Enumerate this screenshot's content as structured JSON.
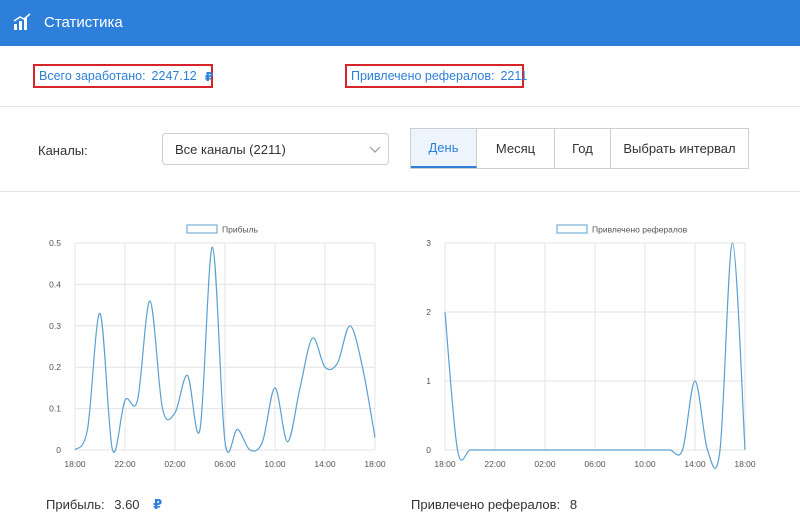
{
  "header": {
    "title": "Статистика",
    "icon": "bar-chart-icon"
  },
  "stats": {
    "earned_label": "Всего заработано:",
    "earned_value": "2247.12",
    "currency": "₽",
    "refs_label": "Привлечено рефералов:",
    "refs_value": "2211"
  },
  "filters": {
    "channels_label": "Каналы:",
    "channels_selected": "Все каналы (2211)",
    "periods": [
      "День",
      "Месяц",
      "Год",
      "Выбрать интервал"
    ],
    "active_period": "День"
  },
  "totals": {
    "profit_label": "Прибыль:",
    "profit_value": "3.60",
    "currency": "₽",
    "refs_label": "Привлечено рефералов:",
    "refs_value": "8"
  },
  "colors": {
    "header": "#2d7fd9",
    "accent": "#2d7fd9",
    "series": "#5ba0d0",
    "highlight_border": "#d6242b"
  },
  "chart_data": [
    {
      "type": "line",
      "legend": "Прибыль",
      "x_tick_labels": [
        "18:00",
        "22:00",
        "02:00",
        "06:00",
        "10:00",
        "14:00",
        "18:00"
      ],
      "y_ticks": [
        0,
        0.1,
        0.2,
        0.3,
        0.4,
        0.5
      ],
      "ylim": [
        0,
        0.5
      ],
      "grid": true,
      "legend_position": "top-center",
      "series": [
        {
          "name": "Прибыль",
          "values": [
            0,
            0.05,
            0.33,
            0,
            0.12,
            0.12,
            0.36,
            0.1,
            0.09,
            0.18,
            0.05,
            0.49,
            0.02,
            0.05,
            0,
            0.02,
            0.15,
            0.02,
            0.15,
            0.27,
            0.2,
            0.21,
            0.3,
            0.2,
            0.03
          ]
        }
      ]
    },
    {
      "type": "line",
      "legend": "Привлечено рефералов",
      "x_tick_labels": [
        "18:00",
        "22:00",
        "02:00",
        "06:00",
        "10:00",
        "14:00",
        "18:00"
      ],
      "y_ticks": [
        0,
        1,
        2,
        3
      ],
      "ylim": [
        0,
        3
      ],
      "grid": true,
      "legend_position": "top-center",
      "series": [
        {
          "name": "Привлечено рефералов",
          "values": [
            2,
            0,
            0,
            0,
            0,
            0,
            0,
            0,
            0,
            0,
            0,
            0,
            0,
            0,
            0,
            0,
            0,
            0,
            0,
            0,
            1,
            0,
            0,
            3,
            0
          ]
        }
      ]
    }
  ]
}
